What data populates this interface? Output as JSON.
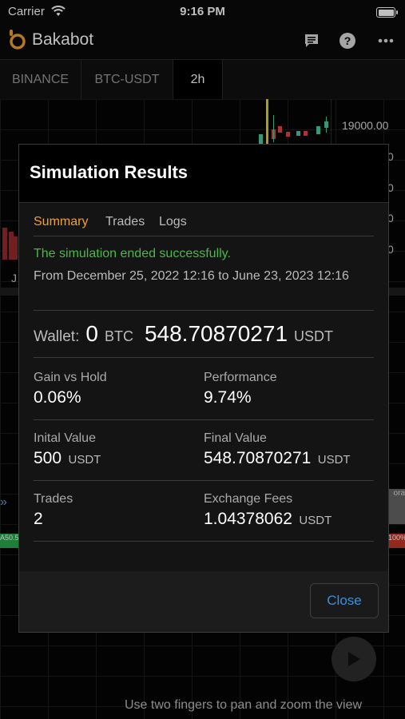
{
  "status_bar": {
    "carrier": "Carrier",
    "time": "9:16 PM"
  },
  "app": {
    "name": "Bakabot"
  },
  "toolbar": {
    "exchange": "BINANCE",
    "pair": "BTC-USDT",
    "interval": "2h"
  },
  "chart": {
    "price_label": "19000.00",
    "right_axis_fragments": [
      "0",
      "0",
      "0",
      "0"
    ],
    "x_fragment": "J",
    "left_marker": "A50.5",
    "right_marker": "100%",
    "right_edge_text": "ora",
    "hint": "Use two fingers to pan and zoom the view"
  },
  "modal": {
    "title": "Simulation Results",
    "tabs": [
      "Summary",
      "Trades",
      "Logs"
    ],
    "active_tab": "Summary",
    "message": "The simulation ended successfully.",
    "period": "From December 25, 2022 12:16 to June 23, 2023 12:16",
    "wallet": {
      "label": "Wallet:",
      "btc_value": "0",
      "btc_unit": "BTC",
      "usdt_value": "548.70870271",
      "usdt_unit": "USDT"
    },
    "gain_vs_hold": {
      "label": "Gain vs Hold",
      "value": "0.06%"
    },
    "performance": {
      "label": "Performance",
      "value": "9.74%"
    },
    "initial_value": {
      "label": "Inital Value",
      "value": "500",
      "unit": "USDT"
    },
    "final_value": {
      "label": "Final Value",
      "value": "548.70870271",
      "unit": "USDT"
    },
    "trades": {
      "label": "Trades",
      "value": "2"
    },
    "exchange_fees": {
      "label": "Exchange Fees",
      "value": "1.04378062",
      "unit": "USDT"
    },
    "close_label": "Close"
  },
  "colors": {
    "accent": "#f0a030",
    "success": "#48b848",
    "link": "#3b8fe0",
    "candle_up": "#4ccaa0",
    "candle_down": "#e0464b"
  }
}
